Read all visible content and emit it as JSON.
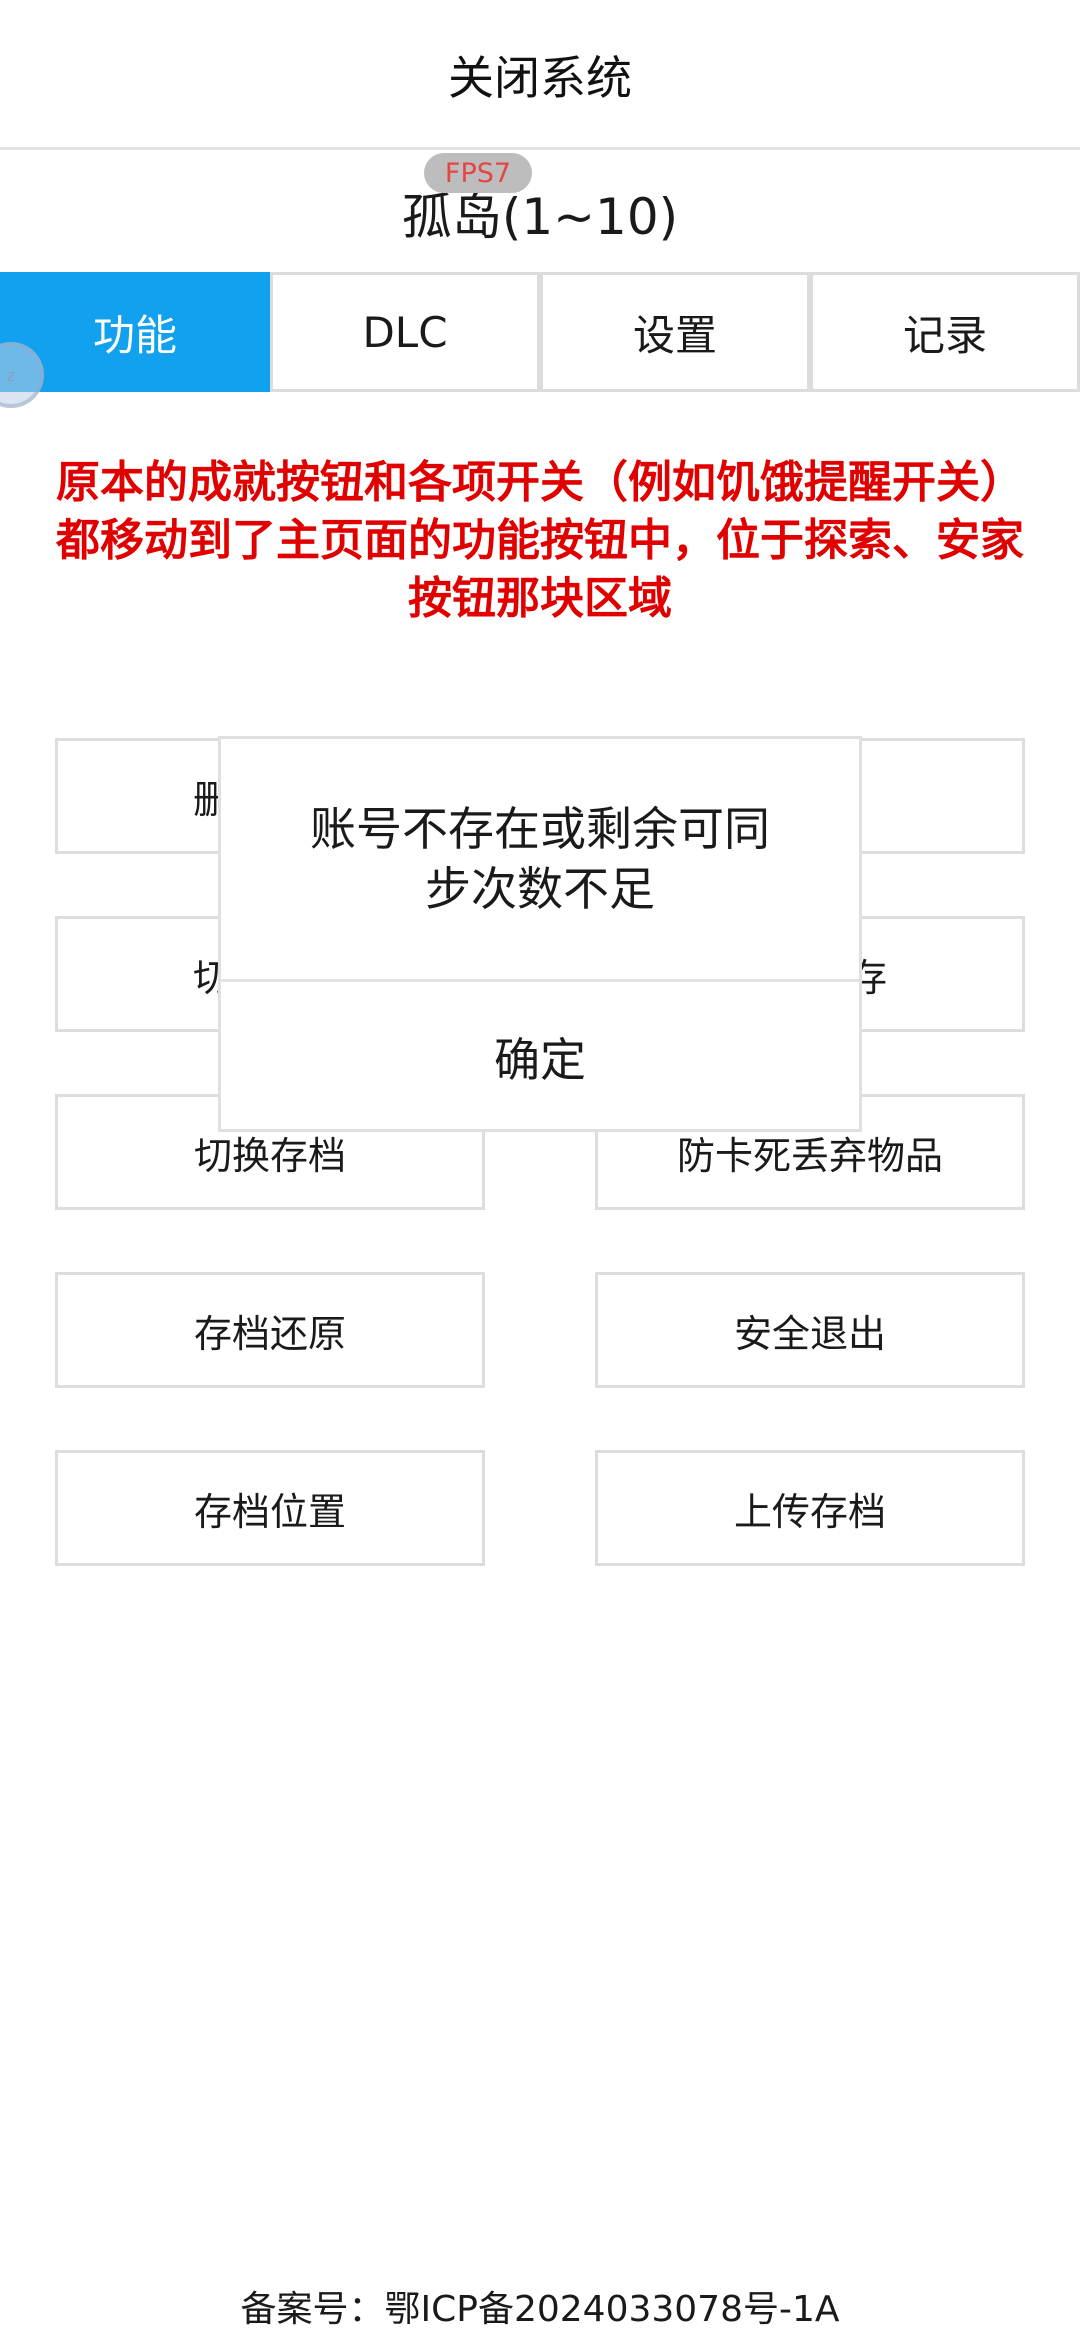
{
  "header": {
    "title": "关闭系统"
  },
  "fps_badge": "FPS7",
  "game_title": "孤岛(1~10)",
  "tabs": [
    {
      "label": "功能",
      "active": true
    },
    {
      "label": "DLC",
      "active": false
    },
    {
      "label": "设置",
      "active": false
    },
    {
      "label": "记录",
      "active": false
    }
  ],
  "float_ball_text": "z",
  "notice": {
    "line1": "原本的成就按钮和各项开关（例如饥饿提醒开关）",
    "line2": "都移动到了主页面的功能按钮中，位于探索、安家",
    "line3": "按钮那块区域"
  },
  "buttons": {
    "row1_left_fragment": "删",
    "row2_left_fragment": "切",
    "row2_right_fragment": "存",
    "switch_save": "切换存档",
    "anti_freeze_drop": "防卡死丢弃物品",
    "restore_save": "存档还原",
    "safe_exit": "安全退出",
    "save_location": "存档位置",
    "upload_save": "上传存档"
  },
  "dialog": {
    "message_line1": "账号不存在或剩余可同",
    "message_line2": "步次数不足",
    "confirm_label": "确定"
  },
  "footer": {
    "icp": "备案号：鄂ICP备2024033078号-1A"
  },
  "colors": {
    "accent": "#11a1ee",
    "notice": "#e00000",
    "fps_text": "#e64545"
  }
}
